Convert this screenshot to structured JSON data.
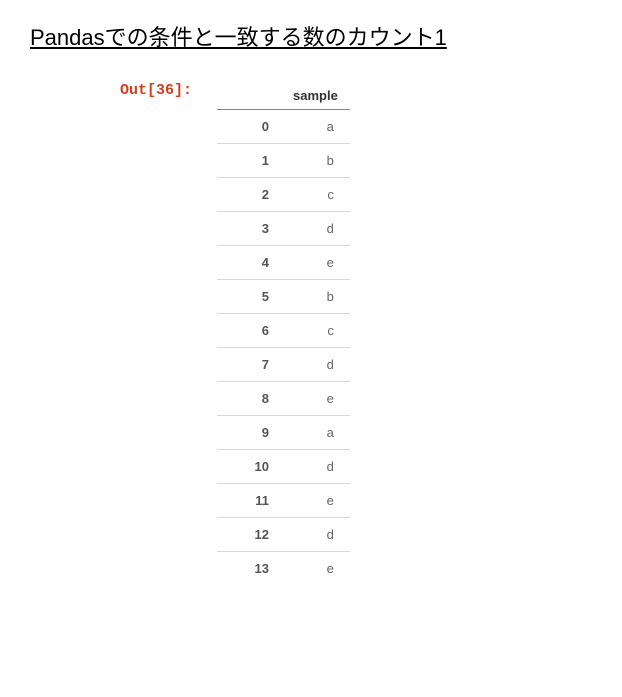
{
  "title": "Pandasでの条件と一致する数のカウント1",
  "output_label": "Out[36]:",
  "chart_data": {
    "type": "table",
    "columns": [
      "sample"
    ],
    "index": [
      0,
      1,
      2,
      3,
      4,
      5,
      6,
      7,
      8,
      9,
      10,
      11,
      12,
      13
    ],
    "rows": [
      {
        "index": 0,
        "sample": "a"
      },
      {
        "index": 1,
        "sample": "b"
      },
      {
        "index": 2,
        "sample": "c"
      },
      {
        "index": 3,
        "sample": "d"
      },
      {
        "index": 4,
        "sample": "e"
      },
      {
        "index": 5,
        "sample": "b"
      },
      {
        "index": 6,
        "sample": "c"
      },
      {
        "index": 7,
        "sample": "d"
      },
      {
        "index": 8,
        "sample": "e"
      },
      {
        "index": 9,
        "sample": "a"
      },
      {
        "index": 10,
        "sample": "d"
      },
      {
        "index": 11,
        "sample": "e"
      },
      {
        "index": 12,
        "sample": "d"
      },
      {
        "index": 13,
        "sample": "e"
      }
    ]
  }
}
